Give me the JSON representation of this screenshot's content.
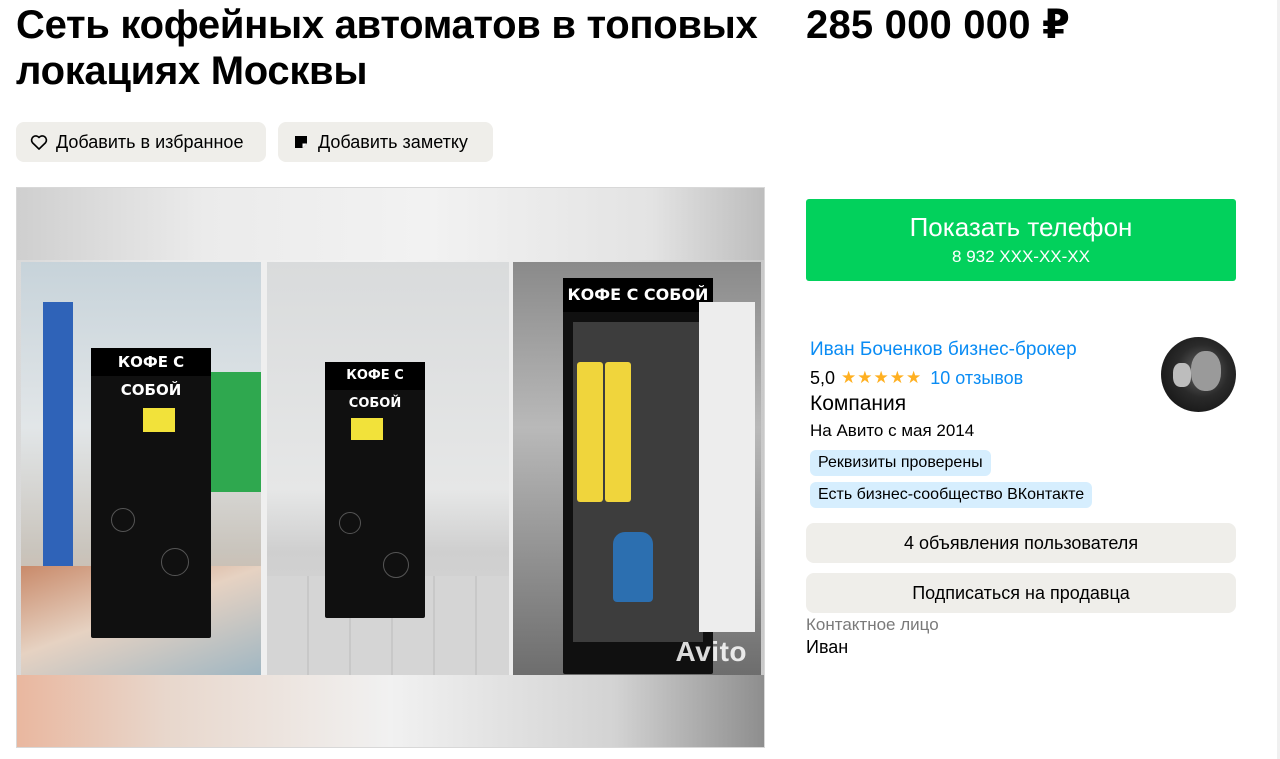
{
  "listing": {
    "title": "Сеть кофейных автоматов в топовых локациях Москвы",
    "price": "285 000 000 ₽"
  },
  "actions": {
    "favorite_label": "Добавить в избранное",
    "note_label": "Добавить заметку"
  },
  "gallery": {
    "sign_text": "КОФЕ С СОБОЙ",
    "watermark": "Avito"
  },
  "contact": {
    "show_phone_label": "Показать телефон",
    "phone_masked": "8 932 XXX-XX-XX"
  },
  "seller": {
    "name": "Иван Боченков бизнес-брокер",
    "rating": "5,0",
    "stars": "★★★★★",
    "reviews": "10 отзывов",
    "type": "Компания",
    "since": "На Авито с мая 2014",
    "badges": [
      "Реквизиты проверены",
      "Есть бизнес-сообщество ВКонтакте"
    ],
    "listings_button": "4 объявления пользователя",
    "subscribe_button": "Подписаться на продавца",
    "contact_person_label": "Контактное лицо",
    "contact_person_name": "Иван"
  },
  "colors": {
    "call_button": "#02d15c",
    "link": "#0a8cf4",
    "star": "#ffb021",
    "chip_bg": "#efeeea",
    "badge_bg": "#d6eefe"
  },
  "icons": {
    "favorite": "heart-icon",
    "note": "note-icon"
  }
}
